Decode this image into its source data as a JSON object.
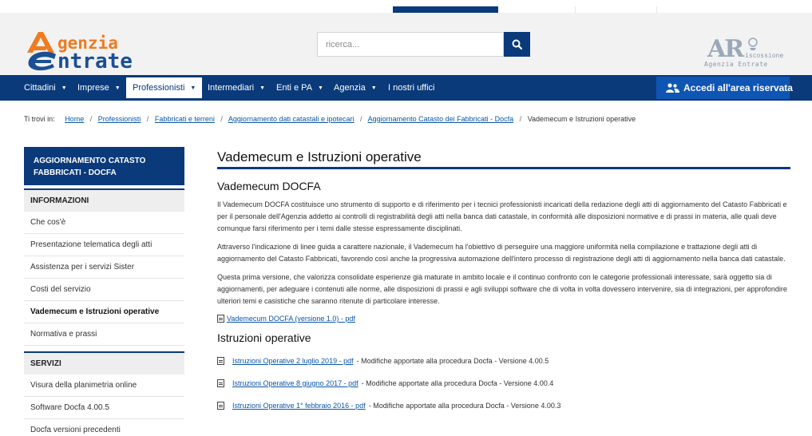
{
  "header": {
    "logo_line1": "genzia",
    "logo_line2": "ntrate",
    "search_placeholder": "ricerca...",
    "ar_letters": "AR",
    "ar_sub1": "iscossione",
    "ar_sub2": "Agenzia Entrate"
  },
  "nav": {
    "items": [
      {
        "label": "Cittadini"
      },
      {
        "label": "Imprese"
      },
      {
        "label": "Professionisti"
      },
      {
        "label": "Intermediari"
      },
      {
        "label": "Enti e PA"
      },
      {
        "label": "Agenzia"
      },
      {
        "label": "I nostri uffici"
      }
    ],
    "reserved_label": "Accedi all'area riservata"
  },
  "breadcrumb": {
    "prefix": "Ti trovi in:",
    "items": [
      "Home",
      "Professionisti",
      "Fabbricati e terreni",
      "Aggiornamento dati catastali e ipotecari",
      "Aggiornamento Catasto dei Fabbricati - Docfa"
    ],
    "current": "Vademecum e Istruzioni operative"
  },
  "sidebar": {
    "header": "AGGIORNAMENTO CATASTO FABBRICATI - DOCFA",
    "section1": "INFORMAZIONI",
    "info_links": [
      "Che cos'è",
      "Presentazione telematica degli atti",
      "Assistenza per i servizi Sister",
      "Costi del servizio",
      "Vademecum e Istruzioni operative",
      "Normativa e prassi"
    ],
    "section2": "SERVIZI",
    "service_links": [
      "Visura della planimetria online",
      "Software Docfa 4.00.5",
      "Docfa versioni precedenti"
    ]
  },
  "main": {
    "title": "Vademecum e Istruzioni operative",
    "h2_vademecum": "Vademecum DOCFA",
    "paragraphs": [
      "Il Vademecum DOCFA costituisce uno strumento di supporto e di riferimento per i tecnici professionisti incaricati della redazione degli atti di aggiornamento del Catasto Fabbricati e per il personale dell'Agenzia addetto ai controlli di registrabilità degli atti nella banca dati catastale, in conformità alle disposizioni normative e di prassi in materia, alle quali deve comunque farsi riferimento per i temi dalle stesse espressamente disciplinati.",
      "Attraverso l'indicazione di linee guida a carattere nazionale, il Vademecum ha l'obiettivo di perseguire una maggiore uniformità nella compilazione e trattazione degli atti di aggiornamento del Catasto Fabbricati, favorendo così anche la progressiva automazione dell'intero processo di registrazione degli atti di aggiornamento nella banca dati catastale.",
      "Questa prima versione, che valorizza consolidate esperienze già maturate in ambito locale e il continuo confronto con le categorie professionali interessate, sarà oggetto sia di aggiornamenti, per adeguare i contenuti alle norme, alle disposizioni di prassi e agli sviluppi software che di volta in volta dovessero intervenire, sia di integrazioni, per approfondire ulteriori temi e casistiche che saranno ritenute di particolare interesse."
    ],
    "vademecum_link": "Vademecum DOCFA (versione 1.0) - pdf",
    "h2_istruzioni": "Istruzioni operative",
    "istruzioni": [
      {
        "link": "Istruzioni Operative 2 luglio 2019 - pdf",
        "desc": "- Modifiche apportate alla procedura Docfa - Versione 4.00.5"
      },
      {
        "link": "Istruzioni Operative 8 giugno 2017 - pdf",
        "desc": "- Modifiche apportate alla procedura Docfa - Versione 4.00.4"
      },
      {
        "link": "Istruzioni Operative 1° febbraio 2016 - pdf",
        "desc": "- Modifiche apportate alla procedura Docfa - Versione 4.00.3"
      }
    ]
  }
}
